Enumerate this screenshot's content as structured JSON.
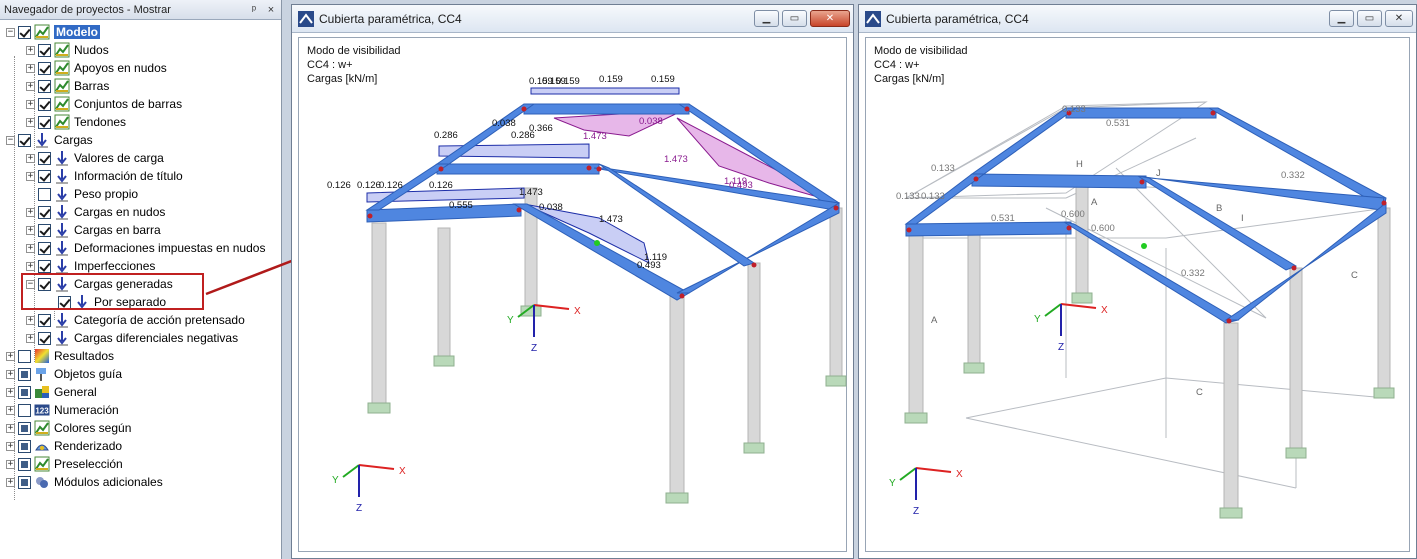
{
  "navigator": {
    "title": "Navegador de proyectos - Mostrar",
    "pin_glyph": "ᵖ",
    "close_glyph": "×",
    "items": [
      {
        "label": "Modelo",
        "icon": "model-icon"
      },
      {
        "label": "Nudos",
        "icon": "model-icon"
      },
      {
        "label": "Apoyos en nudos",
        "icon": "model-icon"
      },
      {
        "label": "Barras",
        "icon": "model-icon"
      },
      {
        "label": "Conjuntos de barras",
        "icon": "model-icon"
      },
      {
        "label": "Tendones",
        "icon": "model-icon"
      },
      {
        "label": "Cargas",
        "icon": "load-arrow-icon"
      },
      {
        "label": "Valores de carga",
        "icon": "load-arrow-icon"
      },
      {
        "label": "Información de título",
        "icon": "load-arrow-icon"
      },
      {
        "label": "Peso propio",
        "icon": "load-arrow-icon"
      },
      {
        "label": "Cargas en nudos",
        "icon": "load-arrow-icon"
      },
      {
        "label": "Cargas en barra",
        "icon": "load-arrow-icon"
      },
      {
        "label": "Deformaciones impuestas en nudos",
        "icon": "load-arrow-icon"
      },
      {
        "label": "Imperfecciones",
        "icon": "load-arrow-icon"
      },
      {
        "label": "Cargas generadas",
        "icon": "load-arrow-icon"
      },
      {
        "label": "Por separado",
        "icon": "load-arrow-icon"
      },
      {
        "label": "Categoría de acción pretensado",
        "icon": "load-arrow-icon"
      },
      {
        "label": "Cargas diferenciales negativas",
        "icon": "load-arrow-icon"
      },
      {
        "label": "Resultados",
        "icon": "results-icon"
      },
      {
        "label": "Objetos guía",
        "icon": "guide-icon"
      },
      {
        "label": "General",
        "icon": "general-icon"
      },
      {
        "label": "Numeración",
        "icon": "numbering-icon"
      },
      {
        "label": "Colores según",
        "icon": "model-icon"
      },
      {
        "label": "Renderizado",
        "icon": "render-icon"
      },
      {
        "label": "Preselección",
        "icon": "model-icon"
      },
      {
        "label": "Módulos adicionales",
        "icon": "modules-icon"
      }
    ],
    "numbering_icon_text": "123"
  },
  "windows": [
    {
      "title": "Cubierta paramétrica, CC4",
      "info": [
        "Modo de visibilidad",
        "CC4 : w+",
        "Cargas [kN/m]"
      ],
      "load_labels": [
        "0.159",
        "0.159",
        "0.159",
        "0.159",
        "0.159",
        "0.286",
        "0.286",
        "0.038",
        "0.366",
        "1.473",
        "0.038",
        "1.473",
        "0.493",
        "1.119",
        "0.126",
        "0.126",
        "0.126",
        "0.126",
        "1.473",
        "0.038",
        "0.555",
        "1.473",
        "1.119",
        "0.493"
      ],
      "axis_labels": {
        "x": "X",
        "y": "Y",
        "z": "Z"
      }
    },
    {
      "title": "Cubierta paramétrica, CC4",
      "info": [
        "Modo de visibilidad",
        "CC4 : w+",
        "Cargas [kN/m]"
      ],
      "load_labels": [
        "0.133",
        "0.531",
        "0.133",
        "0.133",
        "0.133",
        "0.531",
        "0.600",
        "0.600",
        "0.332",
        "0.332"
      ],
      "region_labels": [
        "H",
        "J",
        "A",
        "B",
        "I",
        "A",
        "C",
        "C"
      ],
      "axis_labels": {
        "x": "X",
        "y": "Y",
        "z": "Z"
      }
    }
  ],
  "colors": {
    "beam": "#4f86e0",
    "beam_dark": "#2d5fb8",
    "column": "#d8d8d8",
    "footing": "#b9d9b9",
    "load_blue": "#1d2ea8",
    "load_purple": "#8a1b8f",
    "highlight": "#c02020"
  }
}
